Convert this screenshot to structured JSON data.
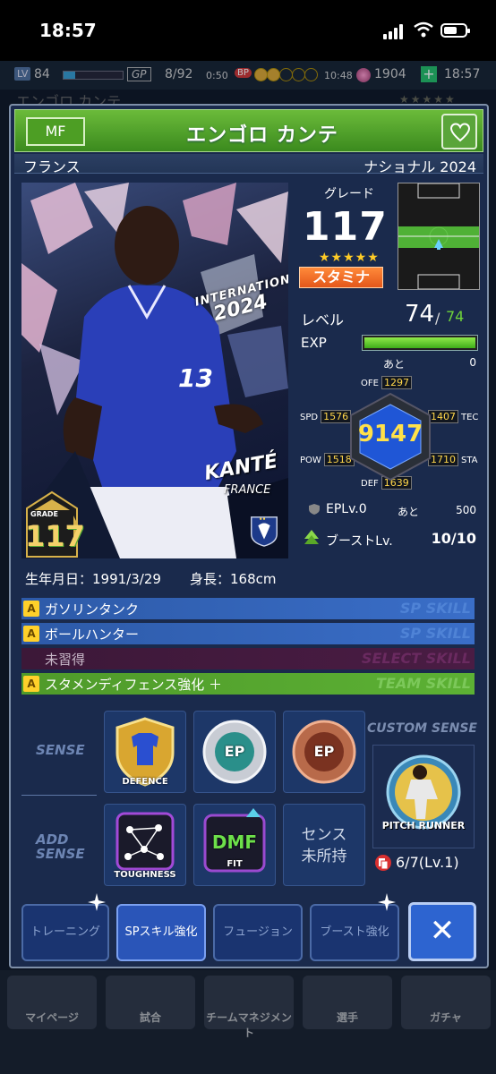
{
  "status_bar": {
    "time": "18:57"
  },
  "game_header": {
    "level_label": "LV",
    "level": "84",
    "gp_label": "GP",
    "stamina": "8/92",
    "timer": "0:50",
    "bp_label": "BP",
    "bp_timer": "10:48",
    "gems": "1904",
    "clock": "18:57"
  },
  "underlying": {
    "name": "エンゴロ カンテ",
    "stars": "★★★★★"
  },
  "dialog": {
    "position": "MF",
    "name": "エンゴロ カンテ",
    "nationality": "フランス",
    "series": "ナショナル 2024",
    "card": {
      "brand_text": "INTERNATIONALS",
      "year_text": "2024",
      "name_text": "KANTÉ",
      "country_text": "FRANCE",
      "grade_label": "GRADE",
      "grade_value": "117"
    },
    "grade_label": "グレード",
    "grade": "117",
    "stars": "★★★★★",
    "type_badge": "スタミナ",
    "level_label": "レベル",
    "level": "74",
    "level_separator": "/",
    "level_max": "74",
    "exp_label": "EXP",
    "exp_progress": 1.0,
    "exp_remaining_label": "あと",
    "exp_remaining": "0",
    "stats": {
      "total": "9147",
      "ofe_label": "OFE",
      "ofe": "1297",
      "spd_label": "SPD",
      "spd": "1576",
      "tec_label": "TEC",
      "tec": "1407",
      "pow_label": "POW",
      "pow": "1518",
      "sta_label": "STA",
      "sta": "1710",
      "def_label": "DEF",
      "def": "1639"
    },
    "ep_level": "EPLv.0",
    "ep_remaining_label": "あと",
    "ep_remaining": "500",
    "boost_label": "ブーストLv.",
    "boost_value": "10/10",
    "birthday": "生年月日：1991/3/29",
    "height": "身長：168cm",
    "skills": [
      {
        "icon": "A",
        "name": "ガソリンタンク",
        "type": "SP SKILL"
      },
      {
        "icon": "A",
        "name": "ボールハンター",
        "type": "SP SKILL"
      },
      {
        "icon": "",
        "name": "未習得",
        "type": "SELECT SKILL"
      },
      {
        "icon": "A",
        "name": "スタメンディフェンス強化 ＋",
        "type": "TEAM SKILL"
      }
    ],
    "sense": {
      "sense_label_1": "SENSE",
      "add_sense_label_1": "ADD",
      "add_sense_label_2": "SENSE",
      "slot1_caption": "DEFENCE",
      "slot2_caption": "EP",
      "slot3_caption": "EP",
      "add1_caption": "TOUGHNESS",
      "add2_main": "DMF",
      "add2_caption": "FIT",
      "no_sense_1": "センス",
      "no_sense_2": "未所持",
      "custom_label": "CUSTOM SENSE",
      "custom_caption": "PITCH RUNNER",
      "custom_count": "6/7(Lv.1)"
    },
    "buttons": {
      "training": "トレーニング",
      "sp_skill": "SPスキル強化",
      "fusion": "フュージョン",
      "boost": "ブースト強化",
      "close": "✕"
    }
  },
  "bottom_nav": {
    "items": [
      "マイページ",
      "試合",
      "チームマネジメント",
      "選手",
      "ガチャ"
    ]
  },
  "colors": {
    "title_green": "#4d9e24",
    "sp_skill_blue": "#2d5aa8",
    "team_skill_green": "#4f9a2a",
    "select_skill_dark": "#3c1838",
    "grade_gold": "#f4d26a",
    "stamina_orange": "#e4571a"
  }
}
